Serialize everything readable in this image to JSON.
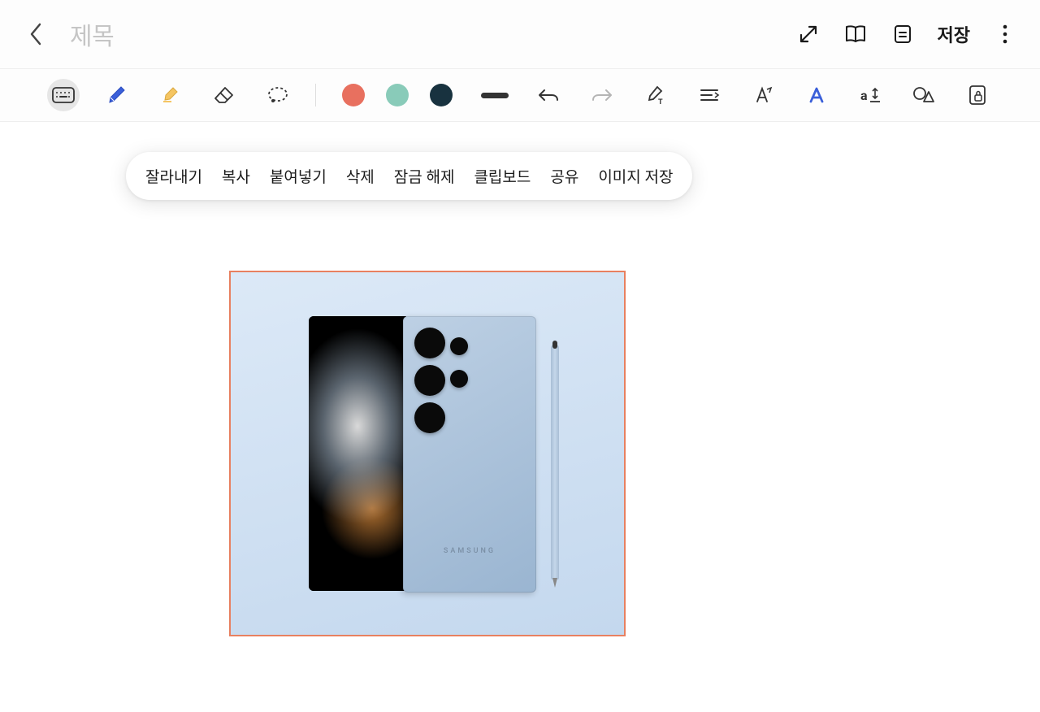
{
  "header": {
    "title_placeholder": "제목",
    "save_label": "저장"
  },
  "toolbar": {
    "colors": {
      "red": "#e8705f",
      "teal": "#89cbb9",
      "dark": "#18323f"
    },
    "icons": {
      "keyboard": "keyboard-icon",
      "pen": "pen-icon",
      "highlighter": "highlighter-icon",
      "eraser": "eraser-icon",
      "lasso": "lasso-icon",
      "line": "line-thickness",
      "undo": "undo-icon",
      "redo": "redo-icon",
      "pen_convert": "pen-to-text-icon",
      "align": "align-icon",
      "text_style": "italic-icon",
      "font": "font-style-icon",
      "text_size": "text-size-icon",
      "shape": "shape-icon",
      "lock": "lock-icon"
    }
  },
  "context_menu": {
    "items": [
      {
        "label": "잘라내기"
      },
      {
        "label": "복사"
      },
      {
        "label": "붙여넣기"
      },
      {
        "label": "삭제"
      },
      {
        "label": "잠금 해제"
      },
      {
        "label": "클립보드"
      },
      {
        "label": "공유"
      },
      {
        "label": "이미지 저장"
      }
    ]
  },
  "image": {
    "brand_text": "SAMSUNG",
    "selection_border": "#e88060"
  }
}
